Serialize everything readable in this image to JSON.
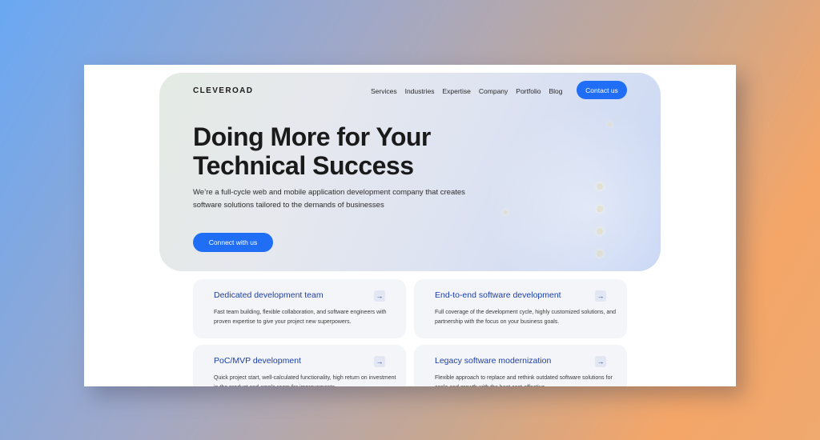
{
  "header": {
    "logo": "CLEVEROAD",
    "nav": [
      "Services",
      "Industries",
      "Expertise",
      "Company",
      "Portfolio",
      "Blog"
    ],
    "contact_label": "Contact us"
  },
  "hero": {
    "headline": "Doing More for Your Technical Success",
    "subtitle": "We’re a full-cycle web and mobile application development company that creates software solutions tailored to the demands of businesses",
    "cta_label": "Connect with us"
  },
  "services": [
    {
      "title": "Dedicated development team",
      "description": "Fast team building, flexible collaboration, and software engineers with proven expertise to give your project new superpowers.",
      "arrow": "→"
    },
    {
      "title": "End-to-end software development",
      "description": "Full coverage of the development cycle, highly customized solutions, and partnership with the focus on your business goals.",
      "arrow": "→"
    },
    {
      "title": "PoC/MVP development",
      "description": "Quick project start, well-calculated functionality, high return on investment in the product and ample room for improvements.",
      "arrow": "→"
    },
    {
      "title": "Legacy software modernization",
      "description": "Flexible approach to replace and rethink outdated software solutions for scale and growth with the best cost-effective...",
      "arrow": "→"
    }
  ]
}
